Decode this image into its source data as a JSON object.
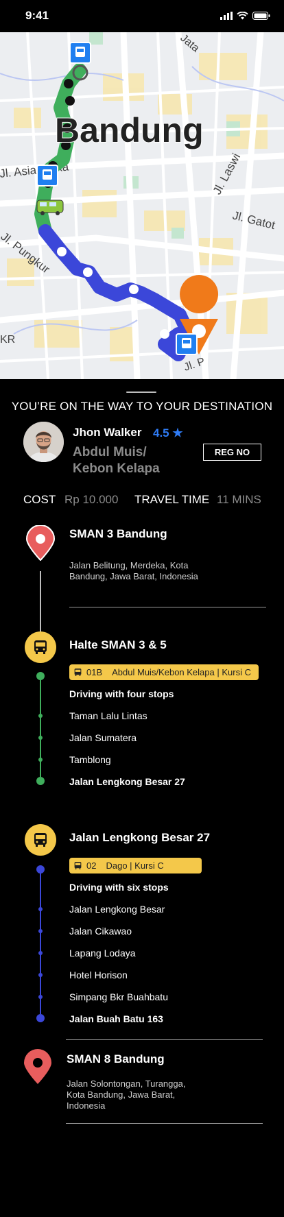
{
  "status_bar": {
    "time": "9:41"
  },
  "map": {
    "city_label": "Bandung",
    "street_labels": [
      "Jl. Asia Afrika",
      "Jl. Laswi",
      "Jl. Gatot",
      "Jl. Pungkur",
      "KR",
      "Jl. P",
      "Jata"
    ]
  },
  "trip": {
    "headline": "YOU’RE ON THE WAY TO YOUR DESTINATION",
    "driver_name": "Jhon Walker",
    "rating": "4.5 ★",
    "route_name": "Abdul Muis/ Kebon Kelapa",
    "reg_button": "REG NO",
    "cost_label": "COST",
    "cost_value": "Rp 10.000",
    "travel_time_label": "TRAVEL TIME",
    "travel_time_value": "11 MINS"
  },
  "origin": {
    "title": "SMAN 3 Bandung",
    "address": "Jalan Belitung, Merdeka, Kota Bandung, Jawa Barat, Indonesia"
  },
  "leg1": {
    "title": "Halte SMAN 3 & 5",
    "route_code": "01B",
    "route_info": "Abdul Muis/Kebon Kelapa | Kursi C",
    "summary": "Driving with four stops",
    "stops": [
      "Taman Lalu Lintas",
      "Jalan Sumatera",
      "Tamblong"
    ],
    "end": "Jalan Lengkong Besar 27",
    "color": "#3fae5c"
  },
  "leg2": {
    "title": "Jalan Lengkong Besar 27",
    "route_code": "02",
    "route_info": "Dago | Kursi C",
    "summary": "Driving with six stops",
    "stops": [
      "Jalan Lengkong Besar",
      "Jalan Cikawao",
      "Lapang Lodaya",
      "Hotel Horison",
      "Simpang Bkr Buahbatu"
    ],
    "end": "Jalan Buah Batu 163",
    "color": "#3b47d9"
  },
  "destination": {
    "title": "SMAN 8 Bandung",
    "address": "Jalan Solontongan, Turangga, Kota Bandung, Jawa Barat, Indonesia"
  }
}
